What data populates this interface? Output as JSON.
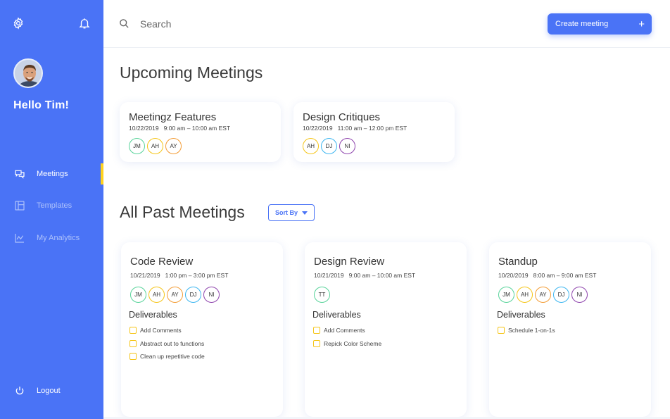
{
  "sidebar": {
    "greeting": "Hello Tim!",
    "nav": [
      {
        "label": "Meetings",
        "icon": "chat-bubbles-icon",
        "active": true
      },
      {
        "label": "Templates",
        "icon": "layout-icon",
        "active": false
      },
      {
        "label": "My Analytics",
        "icon": "line-chart-icon",
        "active": false
      }
    ],
    "logout_label": "Logout"
  },
  "header": {
    "search_placeholder": "Search",
    "create_label": "Create meeting",
    "create_plus": "+"
  },
  "upcoming": {
    "title": "Upcoming Meetings",
    "meetings": [
      {
        "title": "Meetingz Features",
        "date": "10/22/2019   9:00 am – 10:00 am EST",
        "attendees": [
          {
            "initials": "JM",
            "color": "#58d39a"
          },
          {
            "initials": "AH",
            "color": "#f5c518"
          },
          {
            "initials": "AY",
            "color": "#f39c35"
          }
        ]
      },
      {
        "title": "Design Critiques",
        "date": "10/22/2019   11:00 am – 12:00 pm EST",
        "attendees": [
          {
            "initials": "AH",
            "color": "#f5c518"
          },
          {
            "initials": "DJ",
            "color": "#3db6f0"
          },
          {
            "initials": "NI",
            "color": "#8e44ad"
          }
        ]
      }
    ]
  },
  "past": {
    "title": "All Past Meetings",
    "sort_label": "Sort By",
    "deliverables_label": "Deliverables",
    "meetings": [
      {
        "title": "Code Review",
        "date": "10/21/2019   1:00 pm – 3:00 pm EST",
        "attendees": [
          {
            "initials": "JM",
            "color": "#58d39a"
          },
          {
            "initials": "AH",
            "color": "#f5c518"
          },
          {
            "initials": "AY",
            "color": "#f39c35"
          },
          {
            "initials": "DJ",
            "color": "#3db6f0"
          },
          {
            "initials": "NI",
            "color": "#8e44ad"
          }
        ],
        "deliverables": [
          "Add Comments",
          "Abstract out to functions",
          "Clean up repetitive code"
        ]
      },
      {
        "title": "Design Review",
        "date": "10/21/2019   9:00 am – 10:00 am EST",
        "attendees": [
          {
            "initials": "TT",
            "color": "#58d39a"
          }
        ],
        "deliverables": [
          "Add Comments",
          "Repick Color Scheme"
        ]
      },
      {
        "title": "Standup",
        "date": "10/20/2019   8:00 am – 9:00 am EST",
        "attendees": [
          {
            "initials": "JM",
            "color": "#58d39a"
          },
          {
            "initials": "AH",
            "color": "#f5c518"
          },
          {
            "initials": "AY",
            "color": "#f39c35"
          },
          {
            "initials": "DJ",
            "color": "#3db6f0"
          },
          {
            "initials": "NI",
            "color": "#8e44ad"
          }
        ],
        "deliverables": [
          "Schedule 1-on-1s"
        ]
      }
    ]
  },
  "colors": {
    "accent": "#4a73f6",
    "active_indicator": "#ffd21e",
    "checkbox": "#f5c518"
  }
}
